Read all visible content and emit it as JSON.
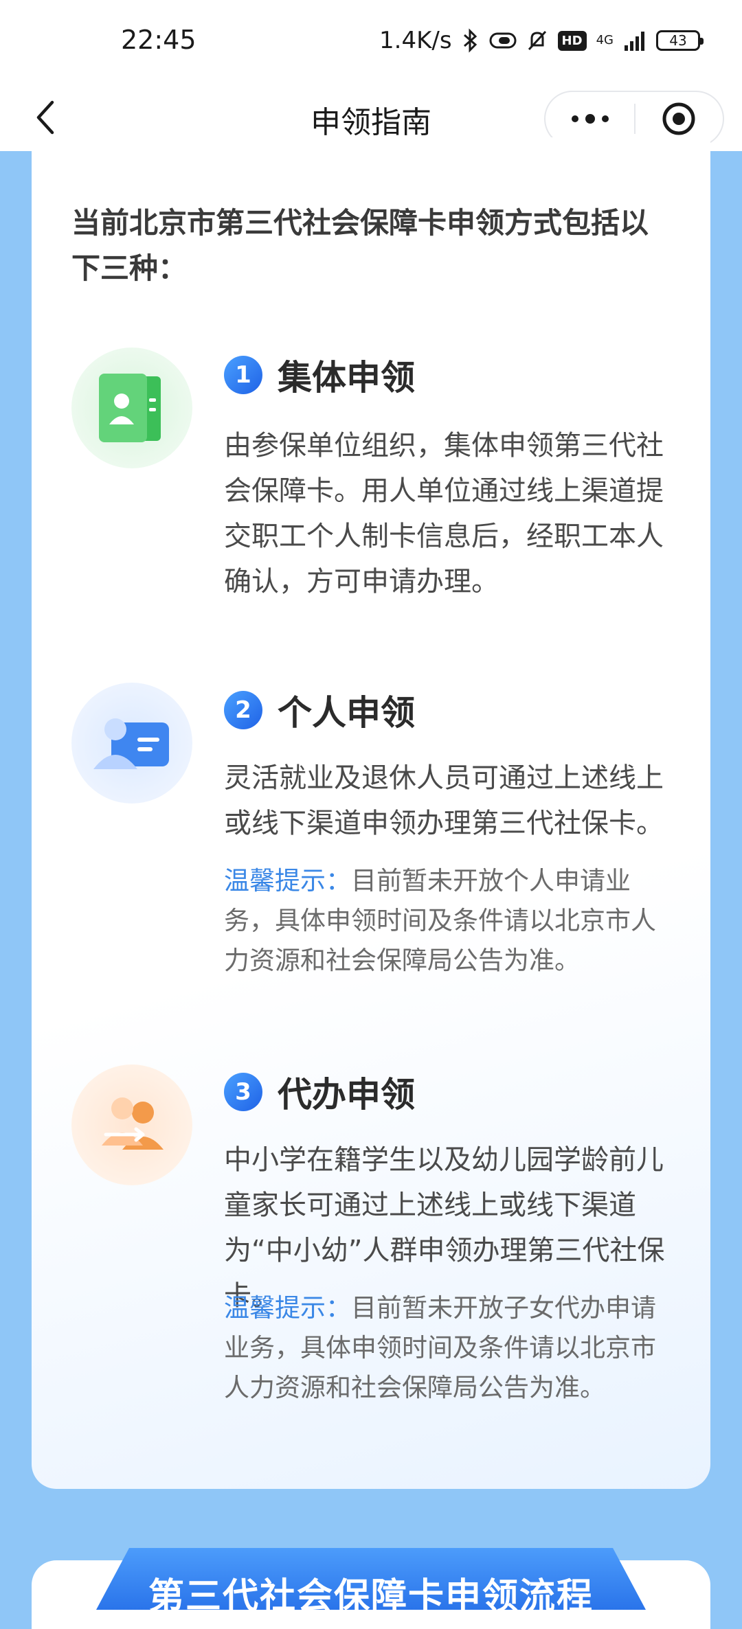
{
  "status_bar": {
    "time": "22:45",
    "net_speed": "1.4K/s",
    "network": "4G",
    "hd_label": "HD",
    "battery": "43",
    "icons": [
      "bluetooth-icon",
      "vibrate-icon",
      "mute-icon",
      "hd-icon",
      "signal-icon",
      "battery-icon"
    ]
  },
  "nav": {
    "title": "申领指南",
    "back_icon": "chevron-left-icon",
    "more_icon": "more-dots-icon",
    "target_icon": "target-icon"
  },
  "intro": "当前北京市第三代社会保障卡申领方式包括以下三种：",
  "sections": [
    {
      "number": "1",
      "title": "集体申领",
      "icon": "id-card-group-icon",
      "body": "由参保单位组织，集体申领第三代社会保障卡。用人单位通过线上渠道提交职工个人制卡信息后，经职工本人确认，方可申请办理。"
    },
    {
      "number": "2",
      "title": "个人申领",
      "icon": "personal-card-icon",
      "body": "灵活就业及退休人员可通过上述线上或线下渠道申领办理第三代社保卡。",
      "tip_label": "温馨提示：",
      "tip_text": "目前暂未开放个人申请业务，具体申领时间及条件请以北京市人力资源和社会保障局公告为准。"
    },
    {
      "number": "3",
      "title": "代办申领",
      "icon": "agent-people-icon",
      "body": "中小学在籍学生以及幼儿园学龄前儿童家长可通过上述线上或线下渠道为“中小幼”人群申领办理第三代社保卡。",
      "tip_label": "温馨提示：",
      "tip_text": "目前暂未开放子女代办申请业务，具体申领时间及条件请以北京市人力资源和社会保障局公告为准。"
    }
  ],
  "flow": {
    "title": "第三代社会保障卡申领流程"
  },
  "colors": {
    "page_bg": "#8fc6f7",
    "accent": "#2a74ea",
    "tip": "#3a87e6"
  }
}
